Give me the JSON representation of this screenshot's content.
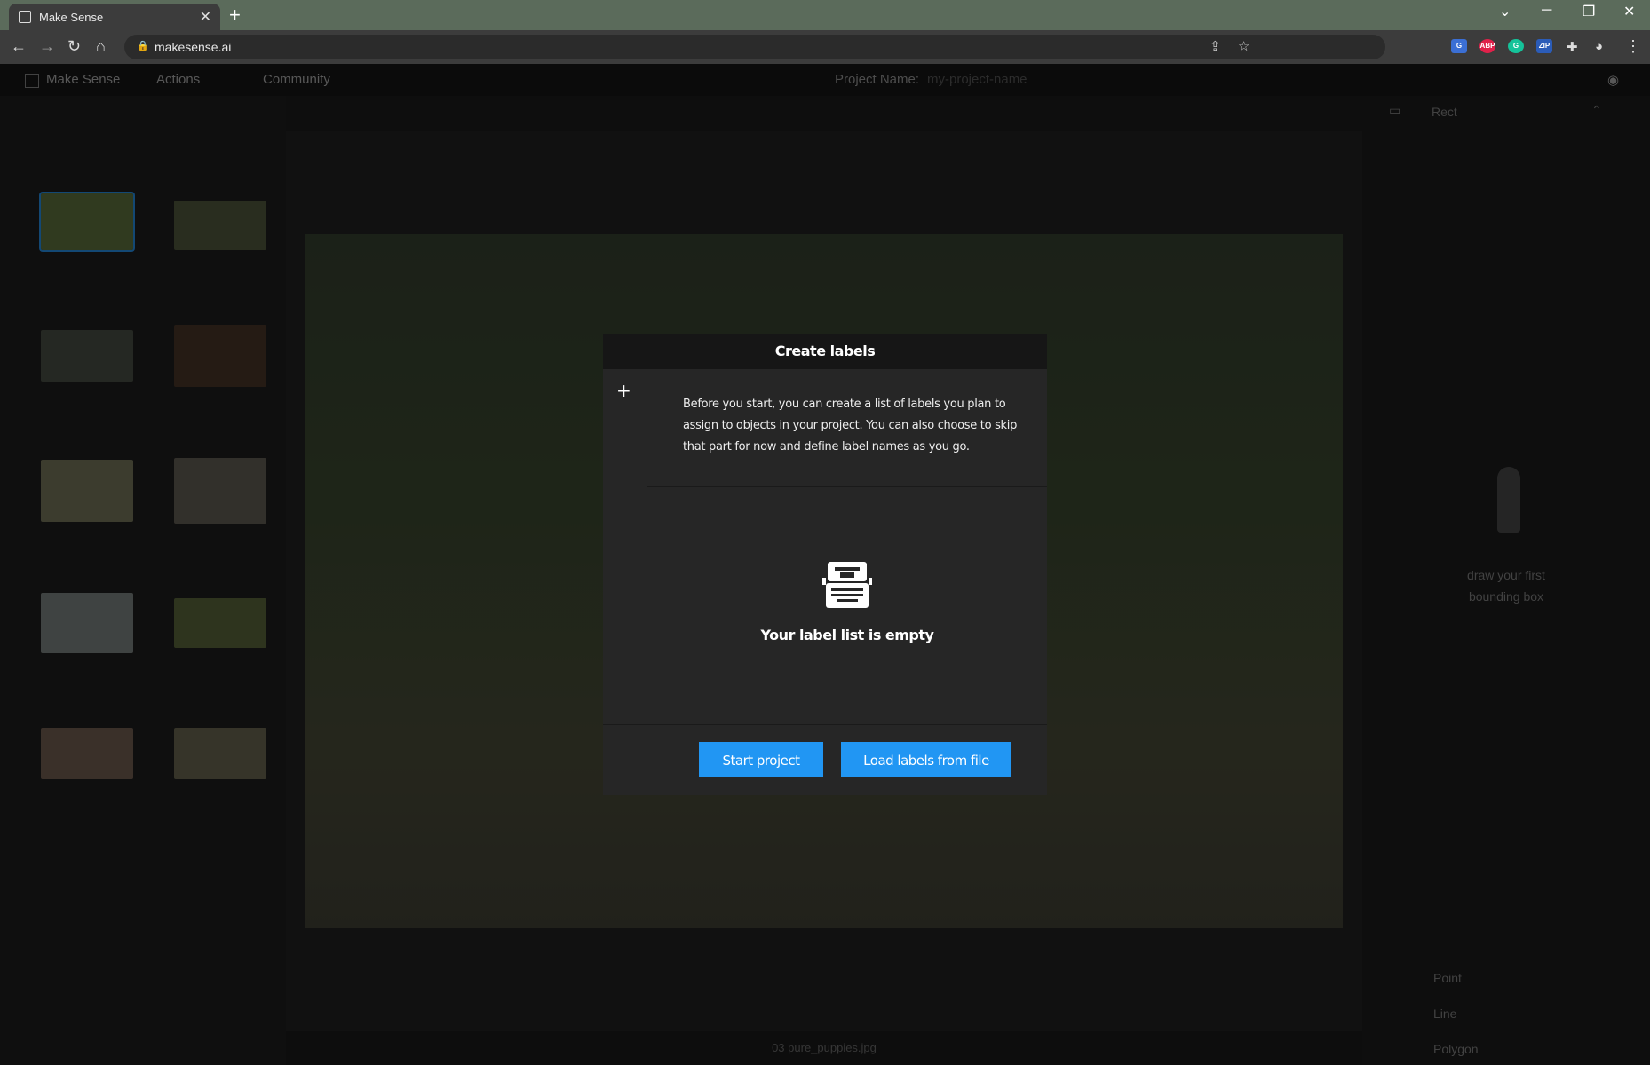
{
  "browser": {
    "tab_title": "Make Sense",
    "tab_close": "✕",
    "new_tab": "+",
    "url": "makesense.ai"
  },
  "app": {
    "brand": "Make Sense",
    "menu_actions": "Actions",
    "menu_community": "Community",
    "project_name_label": "Project Name:",
    "project_name_placeholder": "my-project-name",
    "right_panel": {
      "rect_label": "Rect",
      "empty_hint_line1": "draw your first",
      "empty_hint_line2": "bounding box",
      "point_label": "Point",
      "line_label": "Line",
      "polygon_label": "Polygon"
    },
    "bottom_filename": "03 pure_puppies.jpg"
  },
  "modal": {
    "title": "Create labels",
    "add_symbol": "+",
    "description": "Before you start, you can create a list of labels you plan to assign to objects in your project. You can also choose to skip that part for now and define label names as you go.",
    "empty_text": "Your label list is empty",
    "start_button": "Start project",
    "load_button": "Load labels from file"
  },
  "colors": {
    "accent": "#2196f3",
    "modal_bg": "#262626",
    "modal_header": "#161616"
  }
}
